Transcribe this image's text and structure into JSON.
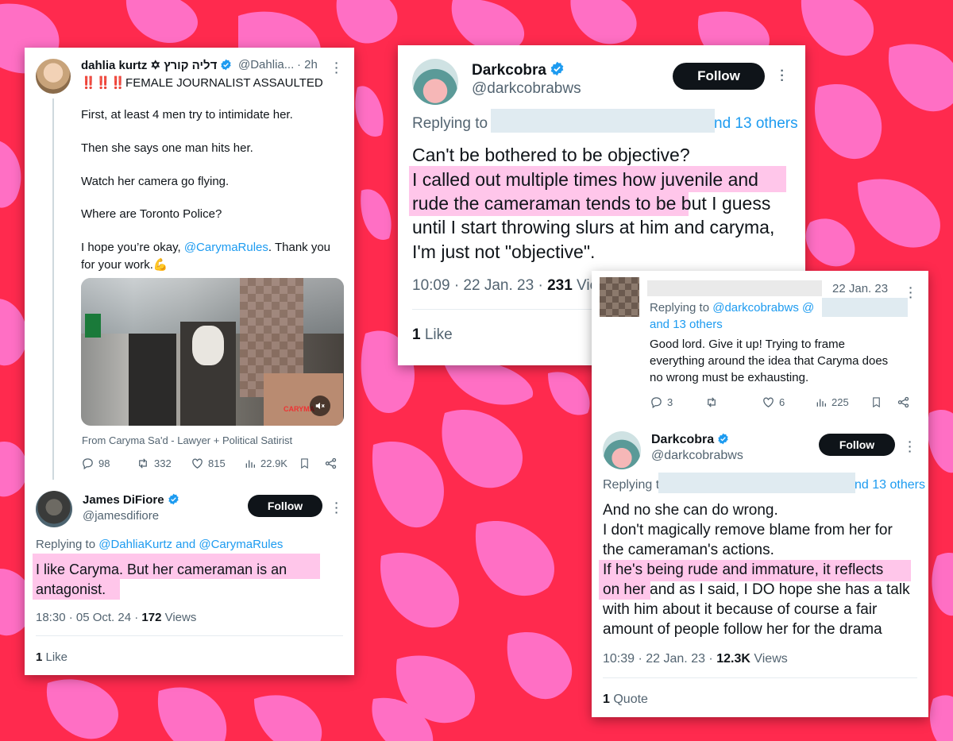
{
  "colors": {
    "background": "#ff2a4e",
    "spots": "#ff6fc4",
    "highlight": "#ffc6ea",
    "link": "#1d9bf0",
    "verified": "#1d9bf0"
  },
  "tweet1": {
    "name": "dahlia kurtz ✡ דליה קורץ",
    "handle": "@Dahlia...",
    "time": "· 2h",
    "lines": [
      "‼️‼️‼️FEMALE JOURNALIST ASSAULTED",
      "First, at least 4 men try to intimidate her.",
      "Then she says one man hits her.",
      "Watch her camera go flying.",
      "Where are Toronto Police?"
    ],
    "last_line1_pre": "I hope you’re okay, ",
    "last_line1_mention": "@CarymaRules",
    "last_line1_post": ". Thank you",
    "last_line2": "for your work.💪",
    "video_watermark": "CARYMA",
    "source": "From Caryma Sa'd - Lawyer + Political Satirist",
    "replies": "98",
    "reposts": "332",
    "likes": "815",
    "views": "22.9K"
  },
  "tweet2": {
    "name": "James DiFiore",
    "handle": "@jamesdifiore",
    "follow": "Follow",
    "replying_prefix": "Replying to ",
    "replying_to": "@DahliaKurtz and @CarymaRules",
    "text_lines": [
      "I like Caryma. But her cameraman is an",
      "antagonist."
    ],
    "time": "18:30 · 05 Oct. 24 · ",
    "views_count": "172",
    "views_label": " Views",
    "likes_count": "1",
    "likes_label": " Like"
  },
  "tweet3": {
    "name": "Darkcobra",
    "handle": "@darkcobrabws",
    "follow": "Follow",
    "replying_prefix": "Replying to",
    "replying_suffix": "nd 13 others",
    "text_lines": [
      "Can't be bothered to be objective?",
      "I called out multiple times how juvenile and",
      "rude the cameraman tends to be",
      " but I guess",
      "until I start throwing slurs at him and caryma,",
      "I'm just not \"objective\"."
    ],
    "time": "10:09 · 22 Jan. 23 · ",
    "views_count": "231",
    "views_label": " Vie",
    "likes_count": "1",
    "likes_label": " Like"
  },
  "tweet4": {
    "date": "22 Jan. 23",
    "replying_prefix": "Replying to ",
    "replying_to": "@darkcobrabws @",
    "replying_line2": "and 13 others",
    "text_lines": [
      "Good lord. Give it up! Trying to frame",
      "everything around the idea that Caryma does",
      "no wrong must be exhausting."
    ],
    "replies": "3",
    "likes": "6",
    "views": "225"
  },
  "tweet5": {
    "name": "Darkcobra",
    "handle": "@darkcobrabws",
    "follow": "Follow",
    "replying_prefix": "Replying t",
    "replying_suffix": "nd 13 others",
    "text_lines": [
      "And no she can do wrong.",
      "I don't magically remove blame from her for",
      "the cameraman's actions.",
      "If he's being rude and immature, it reflects",
      "on her",
      " and as I said, I DO hope she has a talk",
      "with him about it because of course a fair",
      "amount of people follow her for the drama"
    ],
    "time": "10:39 · 22 Jan. 23 · ",
    "views_count": "12.3K",
    "views_label": " Views",
    "quotes_count": "1",
    "quotes_label": " Quote"
  }
}
